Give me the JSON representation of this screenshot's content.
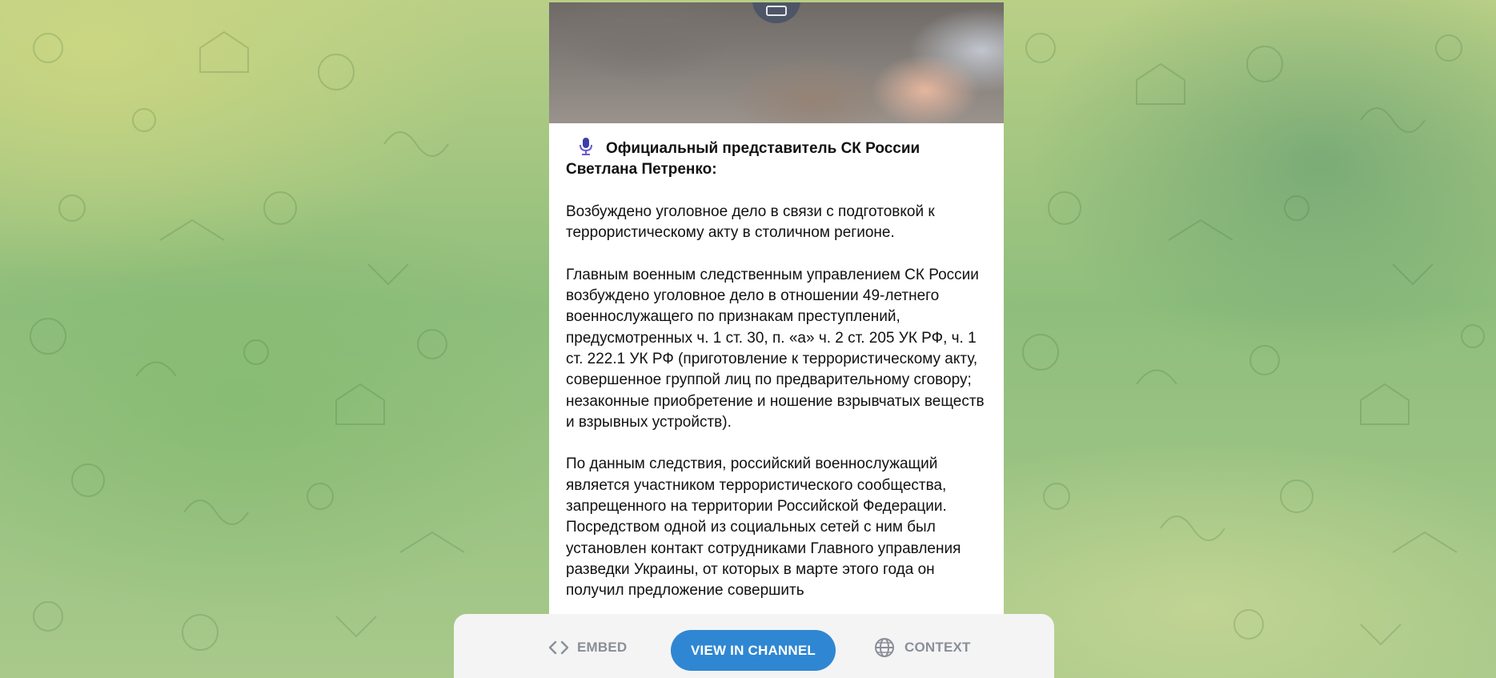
{
  "post": {
    "title_line1": "Официальный представитель СК России",
    "title_line2": "Светлана Петренко:",
    "paragraphs": [
      "Возбуждено уголовное дело в связи с подготовкой к террористическому акту в столичном регионе.",
      "Главным военным следственным управлением СК России возбуждено уголовное дело в отношении 49-летнего военнослужащего по признакам преступлений, предусмотренных ч. 1 ст. 30, п. «а» ч. 2 ст. 205 УК РФ, ч. 1 ст. 222.1 УК РФ (приготовление к террористическому акту, совершенное группой лиц по предварительному сговору; незаконные приобретение и ношение взрывчатых веществ и взрывных устройств).",
      "По данным следствия, российский военнослужащий является участником террористического сообщества, запрещенного на территории Российской Федерации. Посредством одной из социальных сетей с ним был установлен контакт сотрудниками Главного управления разведки Украины, от которых в марте этого года он получил предложение совершить"
    ],
    "lead_icon": "microphone-icon"
  },
  "footer": {
    "embed_label": "EMBED",
    "view_label": "VIEW IN CHANNEL",
    "context_label": "CONTEXT"
  },
  "colors": {
    "accent": "#2f87d3",
    "footer_bg": "#f4f4f5",
    "muted_text": "#8a8f98"
  }
}
